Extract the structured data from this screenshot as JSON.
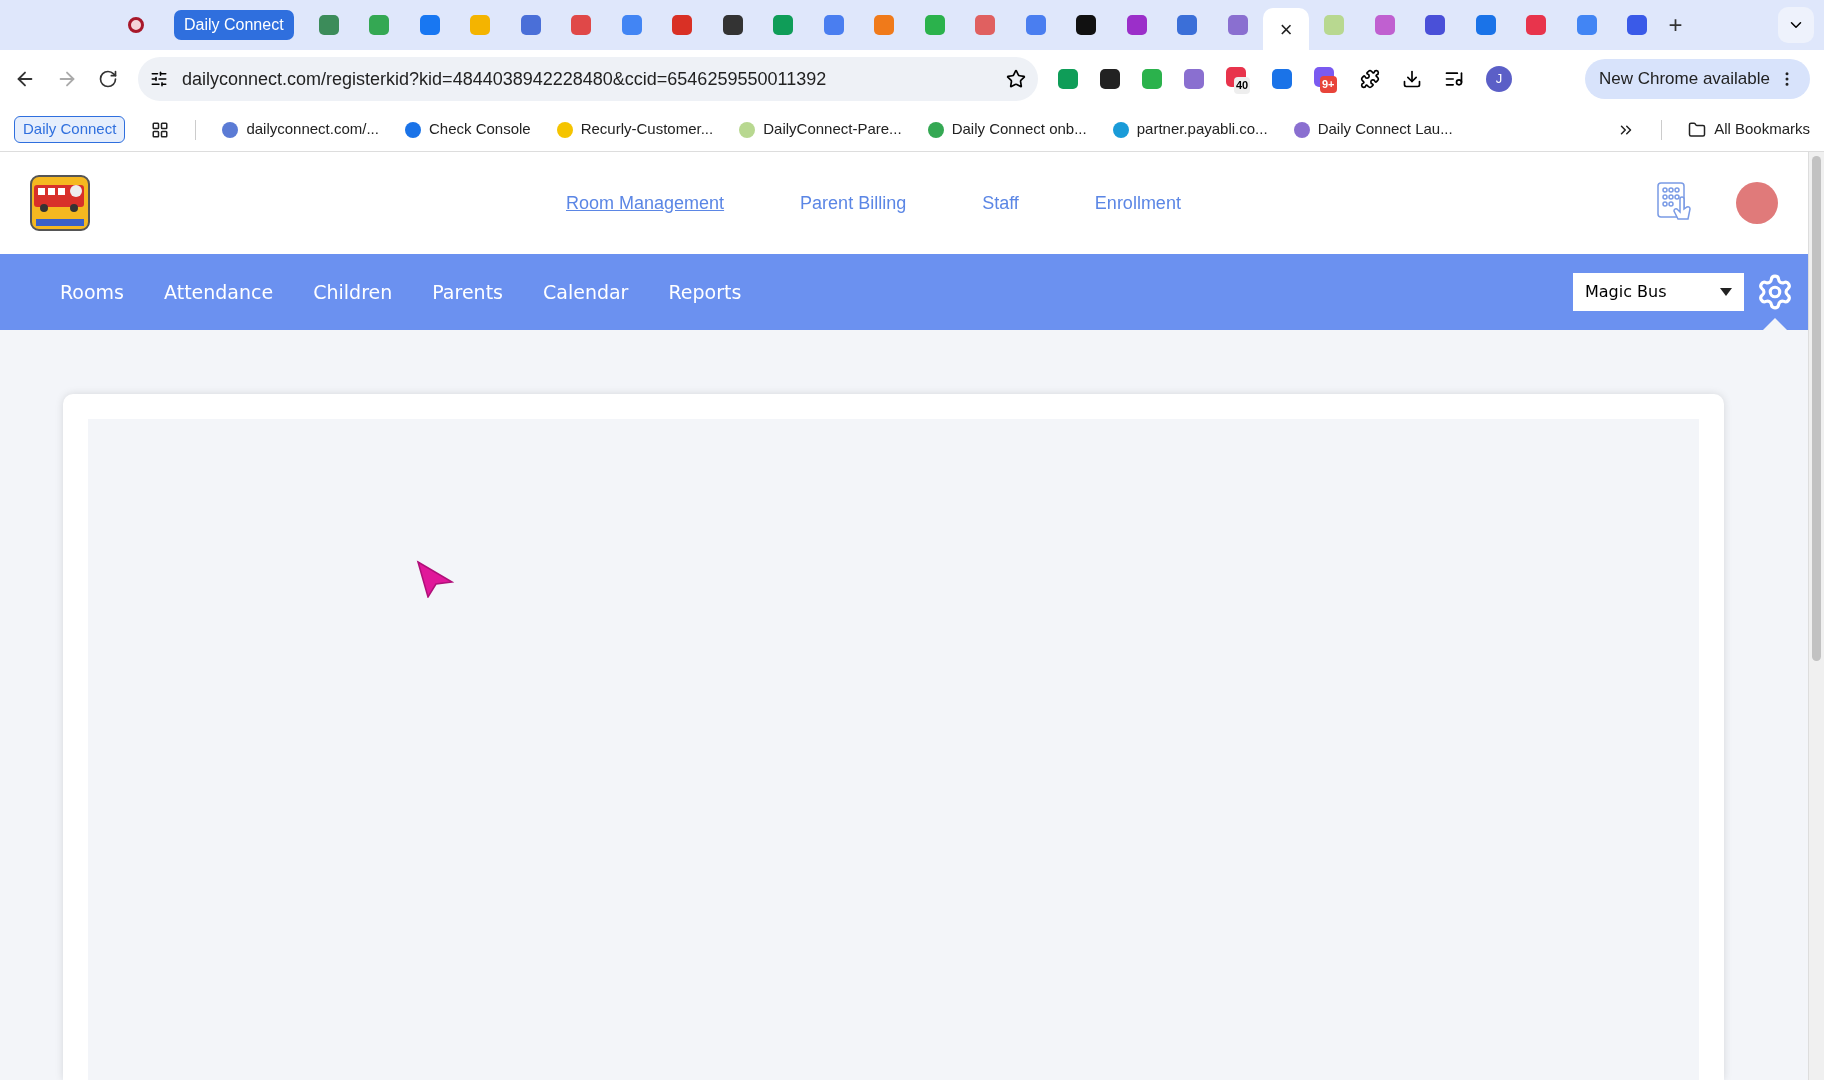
{
  "browser": {
    "tab_group": {
      "label": "Daily Connect"
    },
    "tabs": [
      {
        "color": "#3c8c5a",
        "selected": false
      },
      {
        "color": "#34a853",
        "selected": false
      },
      {
        "color": "#1877f2",
        "selected": false
      },
      {
        "color": "#f4b400",
        "selected": false
      },
      {
        "color": "#4a6fd8",
        "selected": false
      },
      {
        "color": "#e04848",
        "selected": false
      },
      {
        "color": "#4285f4",
        "selected": false
      },
      {
        "color": "#d93025",
        "selected": false
      },
      {
        "color": "#333333",
        "selected": false
      },
      {
        "color": "#0f9d58",
        "selected": false
      },
      {
        "color": "#4a7ef0",
        "selected": false
      },
      {
        "color": "#f07a1a",
        "selected": false
      },
      {
        "color": "#2bb24c",
        "selected": false
      },
      {
        "color": "#e06060",
        "selected": false
      },
      {
        "color": "#4a7ef0",
        "selected": false
      },
      {
        "color": "#111111",
        "selected": false
      },
      {
        "color": "#9b2fc9",
        "selected": false
      },
      {
        "color": "#3b6fd8",
        "selected": false
      },
      {
        "color": "#8a6fd0",
        "selected": false
      },
      {
        "selected": true,
        "close": "×"
      },
      {
        "color": "#b8d890",
        "selected": false
      },
      {
        "color": "#c060d0",
        "selected": false
      },
      {
        "color": "#4a50d8",
        "selected": false
      },
      {
        "color": "#1a73e8",
        "selected": false
      },
      {
        "color": "#e8344c",
        "selected": false
      },
      {
        "color": "#4285f4",
        "selected": false
      },
      {
        "color": "#3a5ae8",
        "selected": false
      }
    ],
    "new_tab": "+",
    "url": "dailyconnect.com/registerkid?kid=4844038942228480&ccid=6546259550011392",
    "extension_badges": [
      "40",
      "9+"
    ],
    "profile_initial": "J",
    "update_button": "New Chrome available",
    "bookmark_group": "Daily Connect",
    "bookmarks": [
      {
        "label": "dailyconnect.com/...",
        "color": "#5b7bd5"
      },
      {
        "label": "Check Console",
        "color": "#1a73e8"
      },
      {
        "label": "Recurly-Customer...",
        "color": "#f5c400"
      },
      {
        "label": "DailyConnect-Pare...",
        "color": "#b8d890"
      },
      {
        "label": "Daily Connect onb...",
        "color": "#34a853"
      },
      {
        "label": "partner.payabli.co...",
        "color": "#1a9bd8"
      },
      {
        "label": "Daily Connect Lau...",
        "color": "#8a6fd0"
      }
    ],
    "all_bookmarks": "All Bookmarks"
  },
  "header": {
    "links": [
      {
        "label": "Room Management",
        "selected": true
      },
      {
        "label": "Parent Billing",
        "selected": false
      },
      {
        "label": "Staff",
        "selected": false
      },
      {
        "label": "Enrollment",
        "selected": false
      }
    ]
  },
  "nav": {
    "items": [
      {
        "label": "Rooms"
      },
      {
        "label": "Attendance"
      },
      {
        "label": "Children"
      },
      {
        "label": "Parents"
      },
      {
        "label": "Calendar"
      },
      {
        "label": "Reports"
      }
    ],
    "center_select": {
      "value": "Magic Bus"
    }
  }
}
